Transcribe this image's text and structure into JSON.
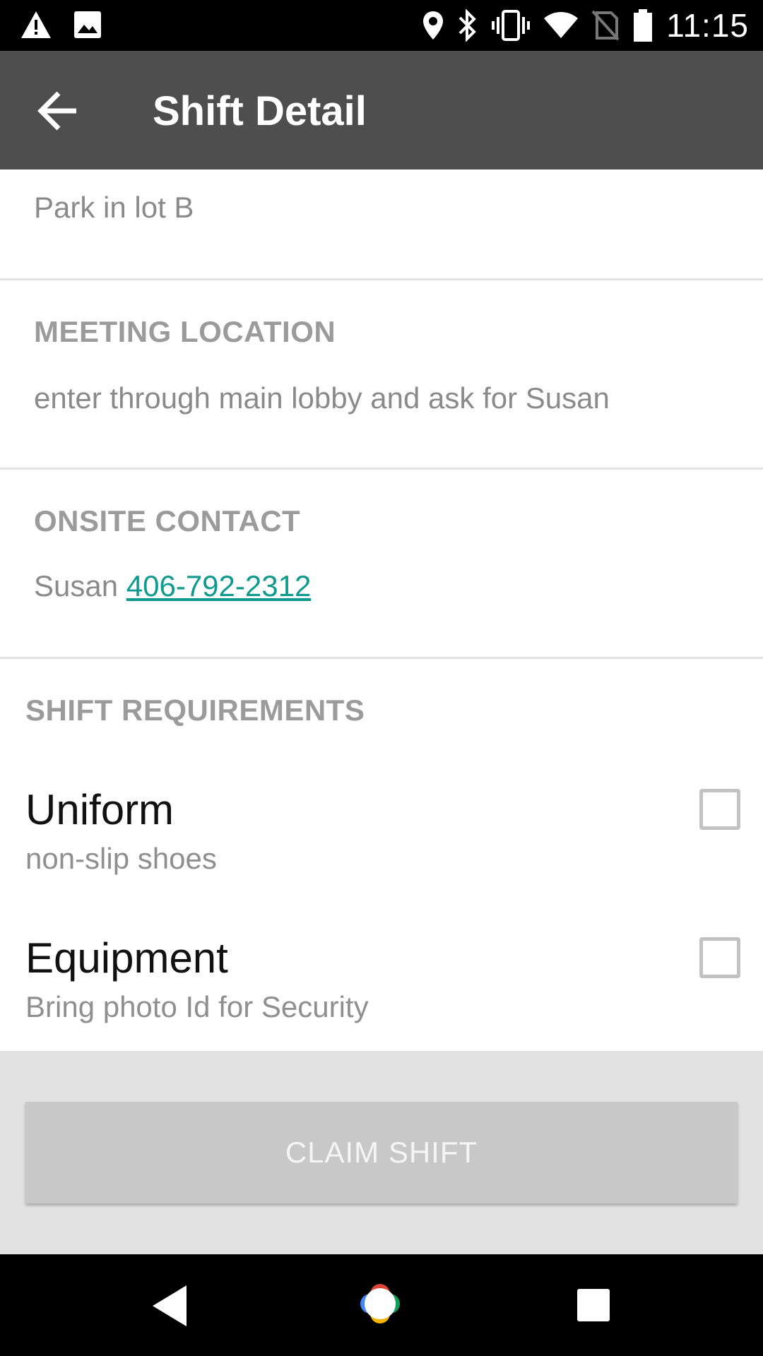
{
  "status_bar": {
    "time": "11:15",
    "icons": [
      "warning-icon",
      "image-icon",
      "location-icon",
      "bluetooth-icon",
      "vibrate-icon",
      "wifi-icon",
      "no-sim-icon",
      "battery-icon"
    ]
  },
  "app_bar": {
    "title": "Shift Detail",
    "back_icon": "arrow-back-icon"
  },
  "parking": {
    "text": "Park in lot B"
  },
  "meeting_location": {
    "label": "MEETING LOCATION",
    "text": "enter through main lobby and ask for Susan"
  },
  "onsite_contact": {
    "label": "ONSITE CONTACT",
    "name": "Susan",
    "phone": "406-792-2312"
  },
  "requirements": {
    "label": "SHIFT REQUIREMENTS",
    "items": [
      {
        "title": "Uniform",
        "subtitle": "non-slip shoes"
      },
      {
        "title": "Equipment",
        "subtitle": "Bring photo Id for Security"
      }
    ]
  },
  "footer": {
    "claim_label": "CLAIM SHIFT"
  },
  "nav_bar": {
    "icons": [
      "nav-back-icon",
      "nav-home-icon",
      "nav-recents-icon"
    ]
  },
  "colors": {
    "app_bar": "#4e4e4e",
    "link": "#0f9a8f",
    "button_disabled": "#c8c8c8"
  }
}
